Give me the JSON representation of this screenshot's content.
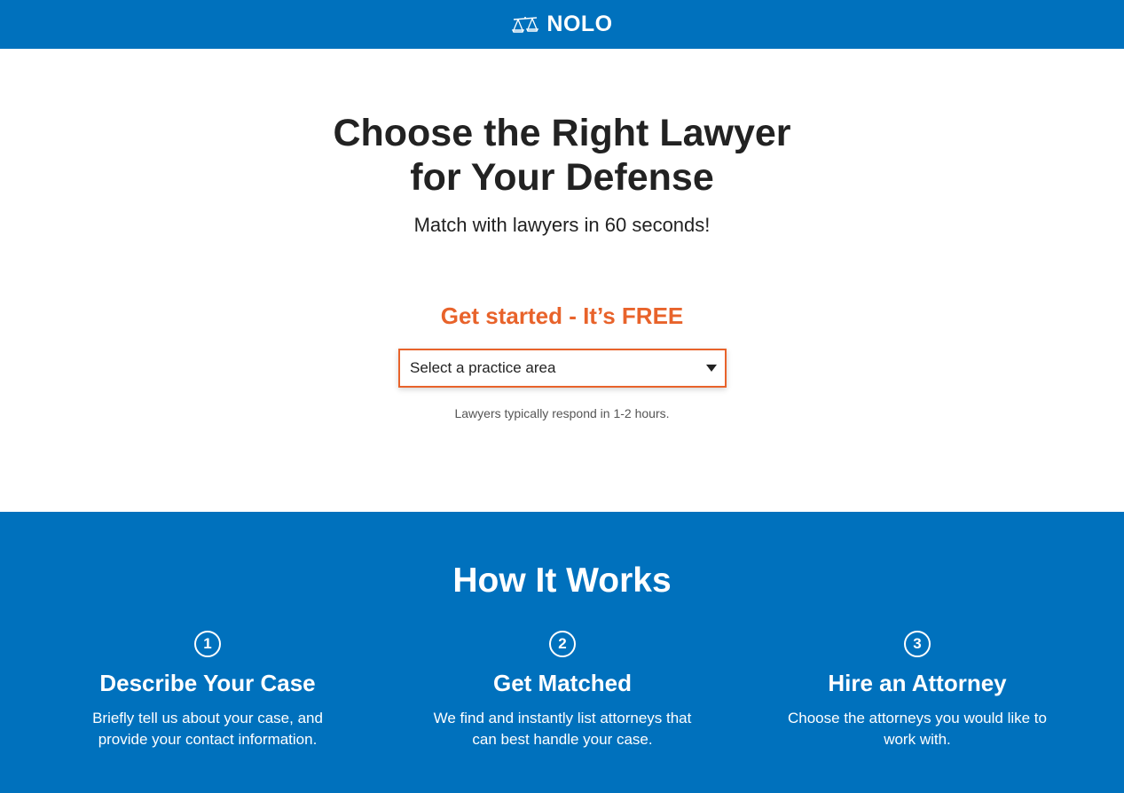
{
  "header": {
    "brand": "NOLO",
    "logo_icon": "scales-of-justice-icon",
    "background": "#0071bd"
  },
  "hero": {
    "title_line1": "Choose the Right Lawyer",
    "title_line2": "for Your Defense",
    "subtitle": "Match with lawyers in 60 seconds!",
    "cta_label": "Get started - It’s FREE",
    "cta_color": "#e8632b",
    "practice_select": {
      "placeholder": "Select a practice area",
      "icon": "caret-down-icon"
    },
    "response_note": "Lawyers typically respond in 1-2 hours."
  },
  "how_it_works": {
    "title": "How It Works",
    "background": "#0071bd",
    "steps": [
      {
        "number": "1",
        "title": "Describe Your Case",
        "description": "Briefly tell us about your case, and provide your contact information."
      },
      {
        "number": "2",
        "title": "Get Matched",
        "description": "We find and instantly list attorneys that can best handle your case."
      },
      {
        "number": "3",
        "title": "Hire an Attorney",
        "description": "Choose the attorneys you would like to work with."
      }
    ]
  }
}
